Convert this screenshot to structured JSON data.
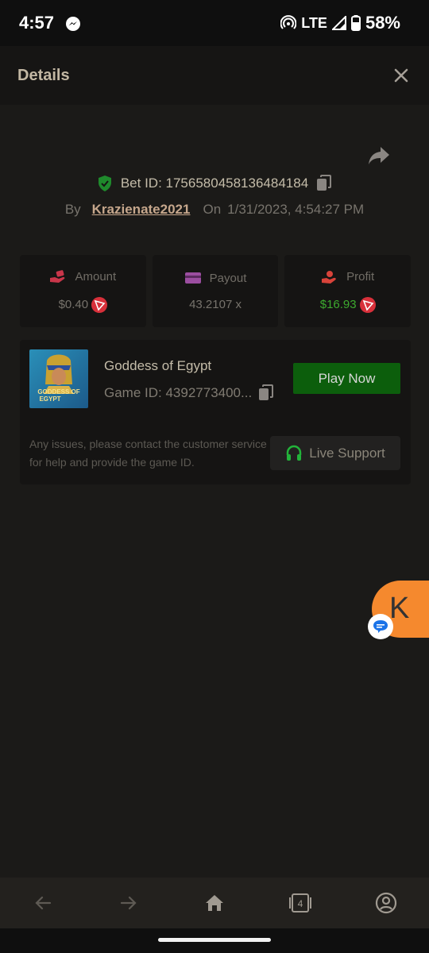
{
  "status_bar": {
    "time": "4:57",
    "network": "LTE",
    "battery": "58%"
  },
  "header": {
    "title": "Details"
  },
  "bet": {
    "id_text": "Bet ID: 1756580458136484184",
    "by_label": "By",
    "username": "Krazienate2021",
    "on_label": "On",
    "date": "1/31/2023, 4:54:27 PM"
  },
  "stats": {
    "amount": {
      "label": "Amount",
      "value": "$0.40"
    },
    "payout": {
      "label": "Payout",
      "value": "43.2107 x"
    },
    "profit": {
      "label": "Profit",
      "value": "$16.93"
    }
  },
  "game": {
    "title": "Goddess of Egypt",
    "id_text": "Game ID: 4392773400...",
    "play_label": "Play Now",
    "thumb_text_line1": "GODDESS OF",
    "thumb_text_line2": "EGYPT"
  },
  "support": {
    "text": "Any issues, please contact the customer service for help and provide the game ID.",
    "button_label": "Live Support"
  },
  "avatar": {
    "letter": "K"
  },
  "nav": {
    "tabs_count": "4"
  },
  "colors": {
    "accent_green": "#0c5e0c",
    "profit_green": "#3daa2f",
    "avatar_orange": "#f5892e",
    "coin_red": "#d8303a"
  }
}
